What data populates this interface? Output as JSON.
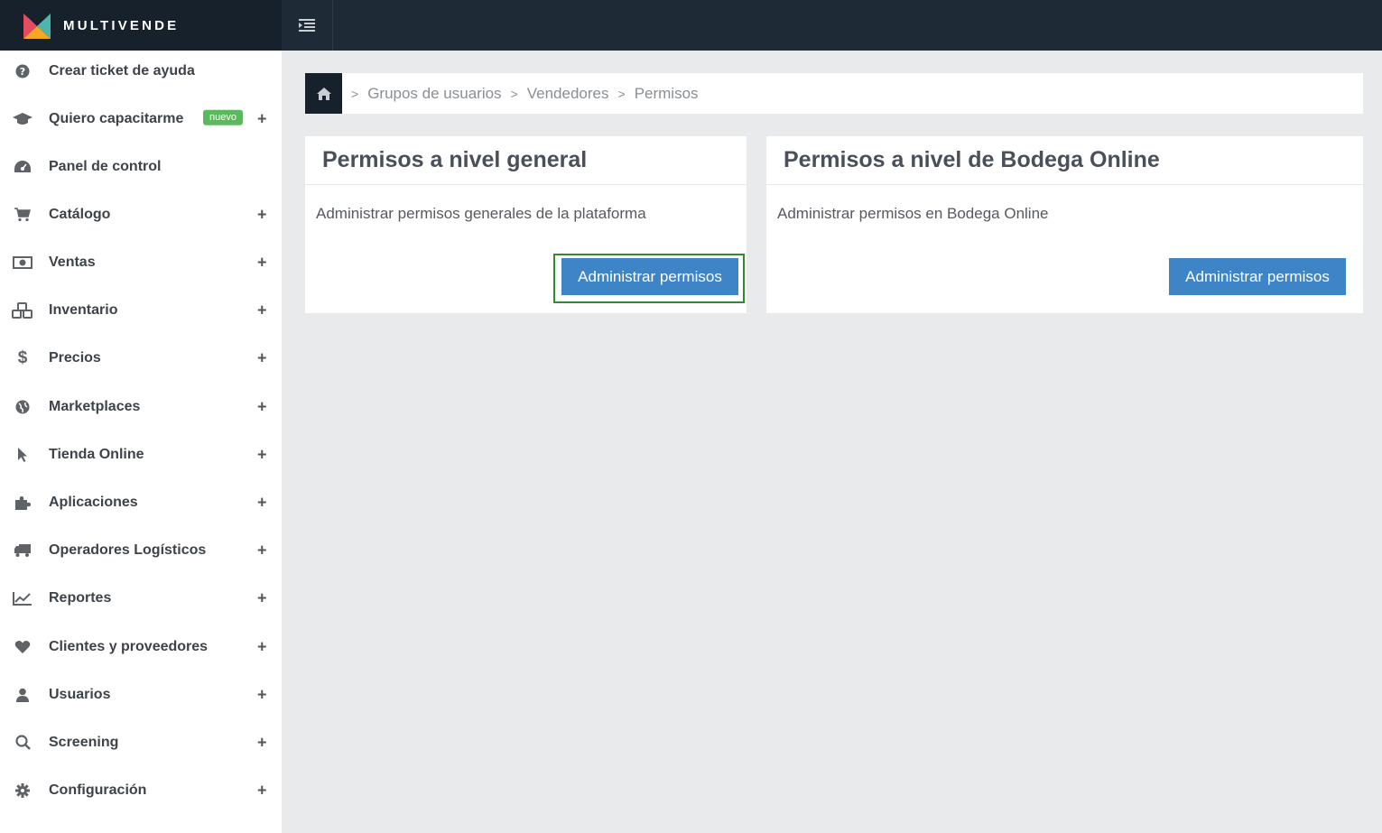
{
  "brand": {
    "name": "MULTIVENDE"
  },
  "sidebar": {
    "items": [
      {
        "label": "Crear ticket de ayuda",
        "icon": "question-circle-icon",
        "expandable": false
      },
      {
        "label": "Quiero capacitarme",
        "icon": "graduation-cap-icon",
        "badge": "nuevo",
        "expandable": true,
        "plus": "+"
      },
      {
        "label": "Panel de control",
        "icon": "dashboard-icon",
        "expandable": false
      },
      {
        "label": "Catálogo",
        "icon": "shopping-cart-icon",
        "expandable": true,
        "plus": "+"
      },
      {
        "label": "Ventas",
        "icon": "money-icon",
        "expandable": true,
        "plus": "+"
      },
      {
        "label": "Inventario",
        "icon": "cubes-icon",
        "expandable": true,
        "plus": "+"
      },
      {
        "label": "Precios",
        "icon": "dollar-icon",
        "expandable": true,
        "plus": "+"
      },
      {
        "label": "Marketplaces",
        "icon": "globe-icon",
        "expandable": true,
        "plus": "+"
      },
      {
        "label": "Tienda Online",
        "icon": "mouse-pointer-icon",
        "expandable": true,
        "plus": "+"
      },
      {
        "label": "Aplicaciones",
        "icon": "puzzle-icon",
        "expandable": true,
        "plus": "+"
      },
      {
        "label": "Operadores Logísticos",
        "icon": "truck-icon",
        "expandable": true,
        "plus": "+"
      },
      {
        "label": "Reportes",
        "icon": "line-chart-icon",
        "expandable": true,
        "plus": "+"
      },
      {
        "label": "Clientes y proveedores",
        "icon": "heart-icon",
        "expandable": true,
        "plus": "+"
      },
      {
        "label": "Usuarios",
        "icon": "user-icon",
        "expandable": true,
        "plus": "+"
      },
      {
        "label": "Screening",
        "icon": "search-icon",
        "expandable": true,
        "plus": "+"
      },
      {
        "label": "Configuración",
        "icon": "gear-icon",
        "expandable": true,
        "plus": "+"
      }
    ]
  },
  "breadcrumb": {
    "home_icon": "home-icon",
    "separator": ">",
    "items": [
      "Grupos de usuarios",
      "Vendedores",
      "Permisos"
    ]
  },
  "cards": [
    {
      "title": "Permisos a nivel general",
      "description": "Administrar permisos generales de la plataforma",
      "button": "Administrar permisos"
    },
    {
      "title": "Permisos a nivel de Bodega Online",
      "description": "Administrar permisos en Bodega Online",
      "button": "Administrar permisos"
    }
  ],
  "colors": {
    "topbar": "#1e2a35",
    "brand_bg": "#16212b",
    "primary_button": "#3d85c6",
    "badge": "#5cb85c",
    "highlight_border": "#2e8b2e",
    "page_bg": "#e8eaeb"
  }
}
